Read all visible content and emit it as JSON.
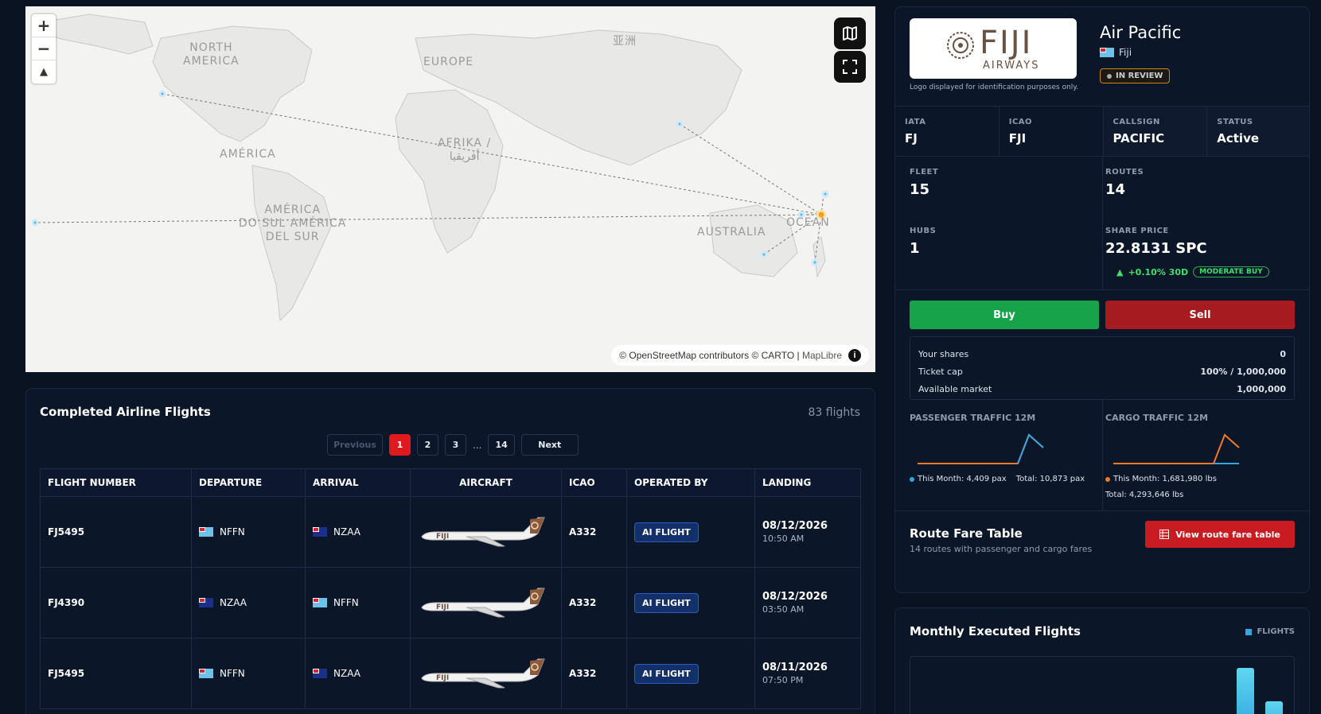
{
  "map": {
    "labels": {
      "north_america": "NORTH\nAMERICA",
      "europe": "EUROPE",
      "asia": "亚洲",
      "america": "AMÉRICA",
      "africa": "AFRIKA /\nأفريقيا",
      "south_america": "AMÉRICA\nDO SUL AMÉRICA\nDEL SUR",
      "australia": "AUSTRALIA",
      "oceania": "OCEAN"
    },
    "zoom_in": "+",
    "zoom_out": "−",
    "compass": "▲",
    "attribution": "© OpenStreetMap contributors © CARTO | ",
    "attribution_link": "MapLibre",
    "info": "i"
  },
  "flights": {
    "title": "Completed Airline Flights",
    "count": "83 flights",
    "pager": {
      "previous": "Previous",
      "pages": [
        "1",
        "2",
        "3"
      ],
      "ellipsis": "...",
      "last": "14",
      "next": "Next"
    },
    "columns": [
      "FLIGHT NUMBER",
      "DEPARTURE",
      "ARRIVAL",
      "AIRCRAFT",
      "ICAO",
      "OPERATED BY",
      "LANDING"
    ],
    "rows": [
      {
        "flight": "FJ5495",
        "dep": "NFFN",
        "dep_flag": "fj",
        "arr": "NZAA",
        "arr_flag": "nz",
        "icao": "A332",
        "operator": "AI FLIGHT",
        "date": "08/12/2026",
        "time": "10:50 AM",
        "livery": "FIJI"
      },
      {
        "flight": "FJ4390",
        "dep": "NZAA",
        "dep_flag": "nz",
        "arr": "NFFN",
        "arr_flag": "fj",
        "icao": "A332",
        "operator": "AI FLIGHT",
        "date": "08/12/2026",
        "time": "03:50 AM",
        "livery": "FIJI"
      },
      {
        "flight": "FJ5495",
        "dep": "NFFN",
        "dep_flag": "fj",
        "arr": "NZAA",
        "arr_flag": "nz",
        "icao": "A332",
        "operator": "AI FLIGHT",
        "date": "08/11/2026",
        "time": "07:50 PM",
        "livery": "FIJI"
      }
    ]
  },
  "airline": {
    "logo_text": "FIJI",
    "logo_sub": "AIRWAYS",
    "logo_note": "Logo displayed for identification purposes only.",
    "name": "Air Pacific",
    "country": "Fiji",
    "review_status": "IN REVIEW",
    "codes": [
      {
        "label": "IATA",
        "value": "FJ"
      },
      {
        "label": "ICAO",
        "value": "FJI"
      },
      {
        "label": "CALLSIGN",
        "value": "PACIFIC"
      },
      {
        "label": "STATUS",
        "value": "Active"
      }
    ],
    "fleet_label": "FLEET",
    "fleet": "15",
    "routes_label": "ROUTES",
    "routes": "14",
    "hubs_label": "HUBS",
    "hubs": "1",
    "share_label": "SHARE PRICE",
    "share_price": "22.8131 SPC",
    "change": "+0.10% 30D",
    "rating": "MODERATE BUY",
    "buy": "Buy",
    "sell": "Sell",
    "shares": [
      {
        "label": "Your shares",
        "value": "0"
      },
      {
        "label": "Ticket cap",
        "value": "100% / 1,000,000"
      },
      {
        "label": "Available market",
        "value": "1,000,000"
      }
    ],
    "passenger_title": "PASSENGER TRAFFIC 12M",
    "passenger_month": "This Month: 4,409 pax",
    "passenger_total": "Total: 10,873 pax",
    "cargo_title": "CARGO TRAFFIC 12M",
    "cargo_month": "This Month: 1,681,980 lbs",
    "cargo_total": "Total: 4,293,646 lbs",
    "fare_title": "Route Fare Table",
    "fare_sub": "14 routes with passenger and cargo fares",
    "fare_button": "View route fare table",
    "colors": {
      "buy": "#17a34a",
      "sell": "#a61b1f",
      "accent_red": "#c91c22",
      "positive": "#3ee06b",
      "series_blue": "#33a6e0",
      "series_orange": "#ef7a27"
    }
  },
  "monthly": {
    "title": "Monthly Executed Flights",
    "legend": "FLIGHTS"
  }
}
